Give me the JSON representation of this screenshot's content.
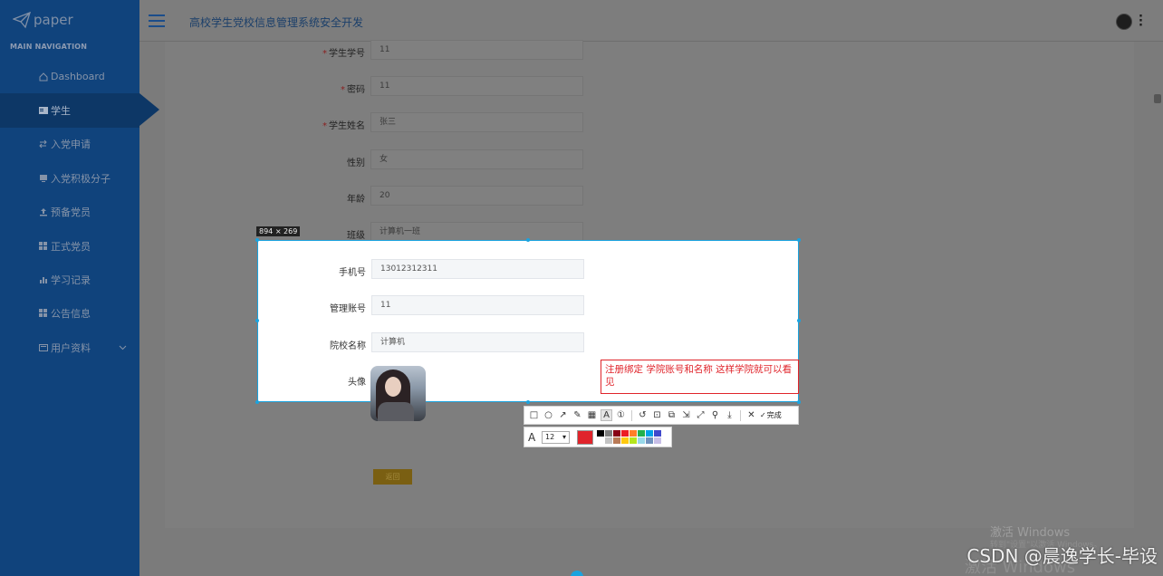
{
  "logo": {
    "text": "paper"
  },
  "sidebar": {
    "section_title": "MAIN NAVIGATION",
    "items": [
      {
        "label": "Dashboard",
        "icon": "home-icon"
      },
      {
        "label": "学生",
        "icon": "idcard-icon"
      },
      {
        "label": "入党申请",
        "icon": "sort-icon"
      },
      {
        "label": "入党积极分子",
        "icon": "monitor-icon"
      },
      {
        "label": "预备党员",
        "icon": "upload-icon"
      },
      {
        "label": "正式党员",
        "icon": "grid-icon"
      },
      {
        "label": "学习记录",
        "icon": "bar-chart-icon"
      },
      {
        "label": "公告信息",
        "icon": "grid-icon"
      },
      {
        "label": "用户资料",
        "icon": "form-icon"
      }
    ]
  },
  "header": {
    "title": "高校学生党校信息管理系统安全开发"
  },
  "form": {
    "fields": [
      {
        "label": "学生学号",
        "value": "11",
        "required": true
      },
      {
        "label": "密码",
        "value": "11",
        "required": true
      },
      {
        "label": "学生姓名",
        "value": "张三",
        "required": true
      },
      {
        "label": "性别",
        "value": "女",
        "required": false
      },
      {
        "label": "年龄",
        "value": "20",
        "required": false
      },
      {
        "label": "班级",
        "value": "计算机一班",
        "required": false
      },
      {
        "label": "手机号",
        "value": "13012312311",
        "required": false
      },
      {
        "label": "管理账号",
        "value": "11",
        "required": false
      },
      {
        "label": "院校名称",
        "value": "计算机",
        "required": false
      }
    ],
    "avatar_label": "头像",
    "submit_label": "返回"
  },
  "capture": {
    "size_badge": "894 × 269",
    "annotation": "注册绑定 学院账号和名称 这样学院就可以看见",
    "done_label": "完成",
    "font_size": "12",
    "current_color": "#e0242b",
    "palette": [
      "#000000",
      "#7f7f7f",
      "#880015",
      "#ed1c24",
      "#ff7f27",
      "#22b14c",
      "#00a2e8",
      "#3f48cc",
      "#ffffff",
      "#c3c3c3",
      "#b97a57",
      "#ffc90e",
      "#b5e61d",
      "#99d9ea",
      "#7092be",
      "#c8bfe7"
    ]
  },
  "watermark": {
    "line1": "激活 Windows",
    "line2": "转到\"设置\"以激活 Windows。",
    "line3": "激活 Windows",
    "csdn": "CSDN @晨逸学长-毕设"
  }
}
